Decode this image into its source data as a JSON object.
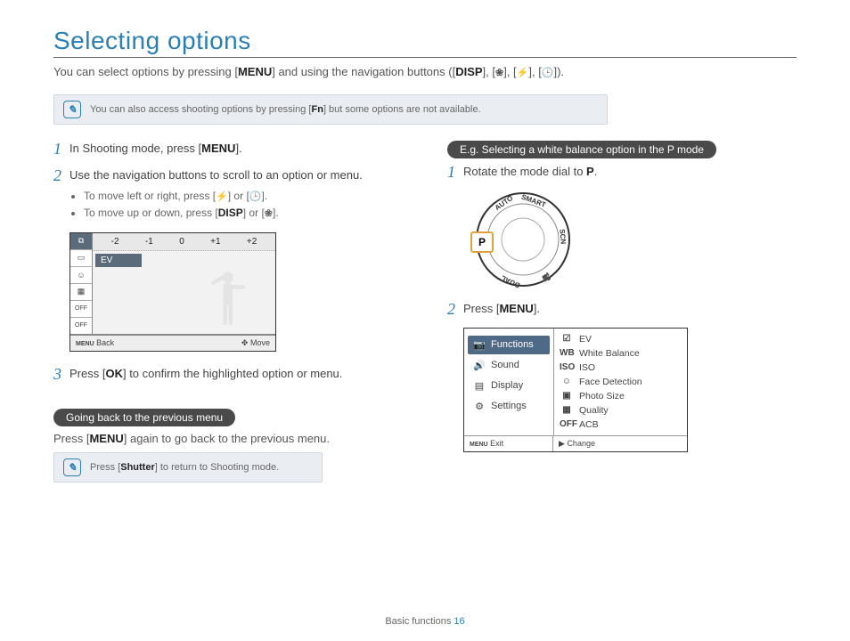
{
  "title": "Selecting options",
  "intro_pre": "You can select options by pressing [",
  "intro_menu": "MENU",
  "intro_mid": "] and using the navigation buttons ([",
  "intro_disp": "DISP",
  "intro_post": "]).",
  "tip1_pre": "You can also access shooting options by pressing [",
  "tip1_fn": "Fn",
  "tip1_post": "] but some options are not available.",
  "left": {
    "s1_pre": "In Shooting mode, press [",
    "s1_b": "MENU",
    "s1_post": "].",
    "s2": "Use the navigation buttons to scroll to an option or menu.",
    "s2a_pre": "To move left or right, press [",
    "s2a_mid": "] or [",
    "s2a_post": "].",
    "s2b_pre": "To move up or down, press [",
    "s2b_b": "DISP",
    "s2b_mid": "] or [",
    "s2b_post": "].",
    "s3_pre": "Press [",
    "s3_b": "OK",
    "s3_post": "] to confirm the highlighted option or menu.",
    "going_pill": "Going back to the previous menu",
    "going_pre": "Press [",
    "going_b": "MENU",
    "going_post": "] again to go back to the previous menu.",
    "tip2_pre": "Press [",
    "tip2_b": "Shutter",
    "tip2_post": "] to return to Shooting mode."
  },
  "lcd": {
    "scale": [
      "-2",
      "-1",
      "0",
      "+1",
      "+2"
    ],
    "label": "EV",
    "back_label": "Back",
    "move_label": "Move",
    "menu_glyph": "MENU",
    "side_top": "⧉",
    "off_glyph": "OFF"
  },
  "right": {
    "example_pill": "E.g. Selecting a white balance option in the P mode",
    "s1_pre": "Rotate the mode dial to ",
    "s1_p": "P",
    "s1_post": ".",
    "s2_pre": "Press [",
    "s2_b": "MENU",
    "s2_post": "].",
    "dial_p": "P"
  },
  "menu": {
    "left_items": [
      {
        "icon": "📷",
        "label": "Functions",
        "active": true
      },
      {
        "icon": "🔊",
        "label": "Sound",
        "active": false
      },
      {
        "icon": "▤",
        "label": "Display",
        "active": false
      },
      {
        "icon": "⚙",
        "label": "Settings",
        "active": false
      }
    ],
    "right_items": [
      {
        "icon": "☑",
        "label": "EV"
      },
      {
        "icon": "WB",
        "label": "White Balance"
      },
      {
        "icon": "ISO",
        "label": "ISO"
      },
      {
        "icon": "☺",
        "label": "Face Detection"
      },
      {
        "icon": "▣",
        "label": "Photo Size"
      },
      {
        "icon": "▦",
        "label": "Quality"
      },
      {
        "icon": "OFF",
        "label": "ACB"
      }
    ],
    "exit_glyph": "MENU",
    "exit_label": "Exit",
    "change_glyph": "▶",
    "change_label": "Change"
  },
  "footer_section": "Basic functions",
  "footer_page": "16"
}
